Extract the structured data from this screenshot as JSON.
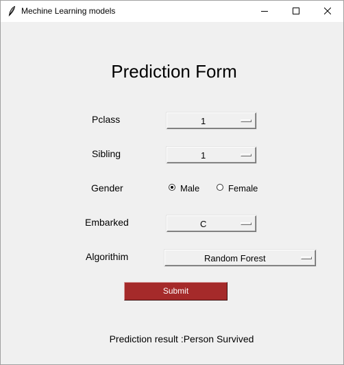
{
  "window": {
    "title": "Mechine Learning models",
    "title_icon": "feather-icon"
  },
  "form": {
    "heading": "Prediction Form",
    "pclass": {
      "label": "Pclass",
      "value": "1"
    },
    "sibling": {
      "label": "Sibling",
      "value": "1"
    },
    "gender": {
      "label": "Gender",
      "options": [
        "Male",
        "Female"
      ],
      "selected": "Male"
    },
    "embarked": {
      "label": "Embarked",
      "value": "C"
    },
    "algorithm": {
      "label": "Algorithim",
      "value": "Random Forest"
    },
    "submit_label": "Submit",
    "result_text": "Prediction result :Person Survived"
  },
  "colors": {
    "submit_bg": "#a52a2a",
    "submit_text": "#ffffff",
    "window_bg": "#f0f0f0"
  }
}
